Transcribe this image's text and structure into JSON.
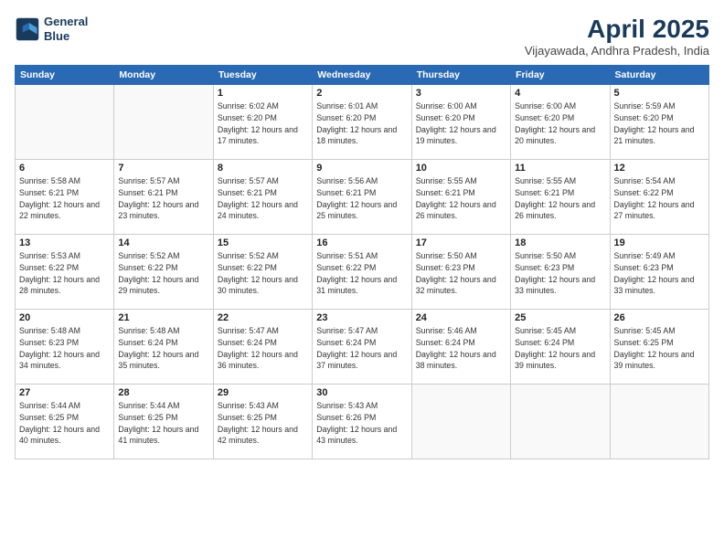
{
  "header": {
    "logo_line1": "General",
    "logo_line2": "Blue",
    "month_title": "April 2025",
    "subtitle": "Vijayawada, Andhra Pradesh, India"
  },
  "weekdays": [
    "Sunday",
    "Monday",
    "Tuesday",
    "Wednesday",
    "Thursday",
    "Friday",
    "Saturday"
  ],
  "weeks": [
    [
      {
        "day": "",
        "sunrise": "",
        "sunset": "",
        "daylight": ""
      },
      {
        "day": "",
        "sunrise": "",
        "sunset": "",
        "daylight": ""
      },
      {
        "day": "1",
        "sunrise": "Sunrise: 6:02 AM",
        "sunset": "Sunset: 6:20 PM",
        "daylight": "Daylight: 12 hours and 17 minutes."
      },
      {
        "day": "2",
        "sunrise": "Sunrise: 6:01 AM",
        "sunset": "Sunset: 6:20 PM",
        "daylight": "Daylight: 12 hours and 18 minutes."
      },
      {
        "day": "3",
        "sunrise": "Sunrise: 6:00 AM",
        "sunset": "Sunset: 6:20 PM",
        "daylight": "Daylight: 12 hours and 19 minutes."
      },
      {
        "day": "4",
        "sunrise": "Sunrise: 6:00 AM",
        "sunset": "Sunset: 6:20 PM",
        "daylight": "Daylight: 12 hours and 20 minutes."
      },
      {
        "day": "5",
        "sunrise": "Sunrise: 5:59 AM",
        "sunset": "Sunset: 6:20 PM",
        "daylight": "Daylight: 12 hours and 21 minutes."
      }
    ],
    [
      {
        "day": "6",
        "sunrise": "Sunrise: 5:58 AM",
        "sunset": "Sunset: 6:21 PM",
        "daylight": "Daylight: 12 hours and 22 minutes."
      },
      {
        "day": "7",
        "sunrise": "Sunrise: 5:57 AM",
        "sunset": "Sunset: 6:21 PM",
        "daylight": "Daylight: 12 hours and 23 minutes."
      },
      {
        "day": "8",
        "sunrise": "Sunrise: 5:57 AM",
        "sunset": "Sunset: 6:21 PM",
        "daylight": "Daylight: 12 hours and 24 minutes."
      },
      {
        "day": "9",
        "sunrise": "Sunrise: 5:56 AM",
        "sunset": "Sunset: 6:21 PM",
        "daylight": "Daylight: 12 hours and 25 minutes."
      },
      {
        "day": "10",
        "sunrise": "Sunrise: 5:55 AM",
        "sunset": "Sunset: 6:21 PM",
        "daylight": "Daylight: 12 hours and 26 minutes."
      },
      {
        "day": "11",
        "sunrise": "Sunrise: 5:55 AM",
        "sunset": "Sunset: 6:21 PM",
        "daylight": "Daylight: 12 hours and 26 minutes."
      },
      {
        "day": "12",
        "sunrise": "Sunrise: 5:54 AM",
        "sunset": "Sunset: 6:22 PM",
        "daylight": "Daylight: 12 hours and 27 minutes."
      }
    ],
    [
      {
        "day": "13",
        "sunrise": "Sunrise: 5:53 AM",
        "sunset": "Sunset: 6:22 PM",
        "daylight": "Daylight: 12 hours and 28 minutes."
      },
      {
        "day": "14",
        "sunrise": "Sunrise: 5:52 AM",
        "sunset": "Sunset: 6:22 PM",
        "daylight": "Daylight: 12 hours and 29 minutes."
      },
      {
        "day": "15",
        "sunrise": "Sunrise: 5:52 AM",
        "sunset": "Sunset: 6:22 PM",
        "daylight": "Daylight: 12 hours and 30 minutes."
      },
      {
        "day": "16",
        "sunrise": "Sunrise: 5:51 AM",
        "sunset": "Sunset: 6:22 PM",
        "daylight": "Daylight: 12 hours and 31 minutes."
      },
      {
        "day": "17",
        "sunrise": "Sunrise: 5:50 AM",
        "sunset": "Sunset: 6:23 PM",
        "daylight": "Daylight: 12 hours and 32 minutes."
      },
      {
        "day": "18",
        "sunrise": "Sunrise: 5:50 AM",
        "sunset": "Sunset: 6:23 PM",
        "daylight": "Daylight: 12 hours and 33 minutes."
      },
      {
        "day": "19",
        "sunrise": "Sunrise: 5:49 AM",
        "sunset": "Sunset: 6:23 PM",
        "daylight": "Daylight: 12 hours and 33 minutes."
      }
    ],
    [
      {
        "day": "20",
        "sunrise": "Sunrise: 5:48 AM",
        "sunset": "Sunset: 6:23 PM",
        "daylight": "Daylight: 12 hours and 34 minutes."
      },
      {
        "day": "21",
        "sunrise": "Sunrise: 5:48 AM",
        "sunset": "Sunset: 6:24 PM",
        "daylight": "Daylight: 12 hours and 35 minutes."
      },
      {
        "day": "22",
        "sunrise": "Sunrise: 5:47 AM",
        "sunset": "Sunset: 6:24 PM",
        "daylight": "Daylight: 12 hours and 36 minutes."
      },
      {
        "day": "23",
        "sunrise": "Sunrise: 5:47 AM",
        "sunset": "Sunset: 6:24 PM",
        "daylight": "Daylight: 12 hours and 37 minutes."
      },
      {
        "day": "24",
        "sunrise": "Sunrise: 5:46 AM",
        "sunset": "Sunset: 6:24 PM",
        "daylight": "Daylight: 12 hours and 38 minutes."
      },
      {
        "day": "25",
        "sunrise": "Sunrise: 5:45 AM",
        "sunset": "Sunset: 6:24 PM",
        "daylight": "Daylight: 12 hours and 39 minutes."
      },
      {
        "day": "26",
        "sunrise": "Sunrise: 5:45 AM",
        "sunset": "Sunset: 6:25 PM",
        "daylight": "Daylight: 12 hours and 39 minutes."
      }
    ],
    [
      {
        "day": "27",
        "sunrise": "Sunrise: 5:44 AM",
        "sunset": "Sunset: 6:25 PM",
        "daylight": "Daylight: 12 hours and 40 minutes."
      },
      {
        "day": "28",
        "sunrise": "Sunrise: 5:44 AM",
        "sunset": "Sunset: 6:25 PM",
        "daylight": "Daylight: 12 hours and 41 minutes."
      },
      {
        "day": "29",
        "sunrise": "Sunrise: 5:43 AM",
        "sunset": "Sunset: 6:25 PM",
        "daylight": "Daylight: 12 hours and 42 minutes."
      },
      {
        "day": "30",
        "sunrise": "Sunrise: 5:43 AM",
        "sunset": "Sunset: 6:26 PM",
        "daylight": "Daylight: 12 hours and 43 minutes."
      },
      {
        "day": "",
        "sunrise": "",
        "sunset": "",
        "daylight": ""
      },
      {
        "day": "",
        "sunrise": "",
        "sunset": "",
        "daylight": ""
      },
      {
        "day": "",
        "sunrise": "",
        "sunset": "",
        "daylight": ""
      }
    ]
  ]
}
